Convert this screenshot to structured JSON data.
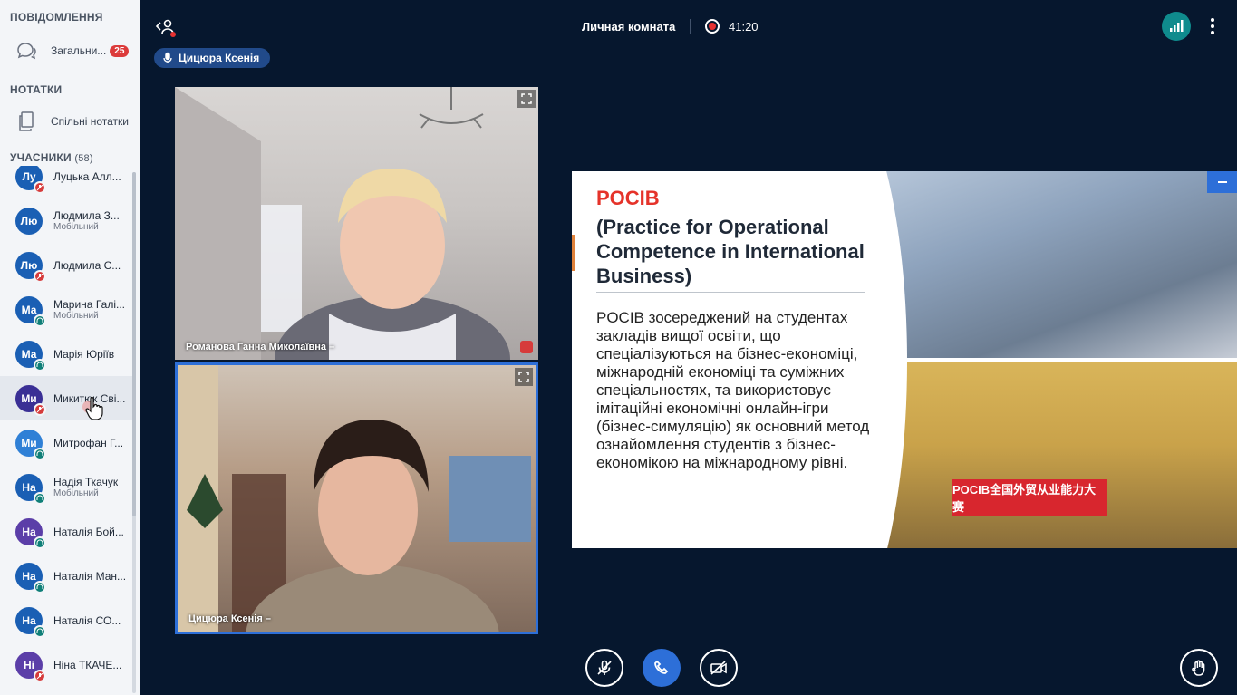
{
  "sidebar": {
    "messages_title": "ПОВІДОМЛЕННЯ",
    "public_chat_label": "Загальни...",
    "public_chat_badge": "25",
    "notes_title": "НОТАТКИ",
    "shared_notes_label": "Спільні нотатки",
    "participants_title": "УЧАСНИКИ",
    "participants_count": "(58)",
    "participants": [
      {
        "initials": "Лу",
        "name": "Луцька Алл...",
        "sub": "",
        "status": "muted"
      },
      {
        "initials": "Лю",
        "name": "Людмила З...",
        "sub": "Мобільний",
        "status": ""
      },
      {
        "initials": "Лю",
        "name": "Людмила С...",
        "sub": "",
        "status": "muted"
      },
      {
        "initials": "Ма",
        "name": "Марина Галі...",
        "sub": "Мобільний",
        "status": "listen"
      },
      {
        "initials": "Ма",
        "name": "Марія Юріїв",
        "sub": "",
        "status": "listen"
      },
      {
        "initials": "Ми",
        "name": "Микитюк Сві...",
        "sub": "",
        "status": "muted"
      },
      {
        "initials": "Ми",
        "name": "Митрофан Г...",
        "sub": "",
        "status": "listen"
      },
      {
        "initials": "На",
        "name": "Надія Ткачук",
        "sub": "Мобільний",
        "status": "listen"
      },
      {
        "initials": "На",
        "name": "Наталія Бой...",
        "sub": "",
        "status": "listen"
      },
      {
        "initials": "На",
        "name": "Наталія Ман...",
        "sub": "",
        "status": "listen"
      },
      {
        "initials": "На",
        "name": "Наталія СО...",
        "sub": "",
        "status": "listen"
      },
      {
        "initials": "Ні",
        "name": "Ніна ТКАЧЕ...",
        "sub": "",
        "status": "muted"
      }
    ]
  },
  "topbar": {
    "room_title": "Личная комната",
    "timer": "41:20",
    "talker_name": "Цицюра Ксенія"
  },
  "videos": [
    {
      "name": "Романова Ганна Миколаївна –"
    },
    {
      "name": "Цицюра Ксенія –"
    }
  ],
  "slide": {
    "title": "POCIB",
    "subtitle": "(Practice for Operational Competence in International Business)",
    "body": "POCIB зосереджений на студентах закладів вищої освіти, що спеціалізуються на бізнес-економіці, міжнародній економіці та суміжних спеціальностях, та використовує імітаційні економічні онлайн-ігри (бізнес-симуляцію) як основний метод ознайомлення студентів з бізнес-економікою на міжнародному рівні.",
    "banner": "POCIB全国外贸从业能力大赛"
  },
  "colors": {
    "background": "#06172e",
    "accent": "#2d6fd8",
    "muted": "#d63b3b",
    "listen": "#0f7f78",
    "slide_title": "#e5332a"
  }
}
